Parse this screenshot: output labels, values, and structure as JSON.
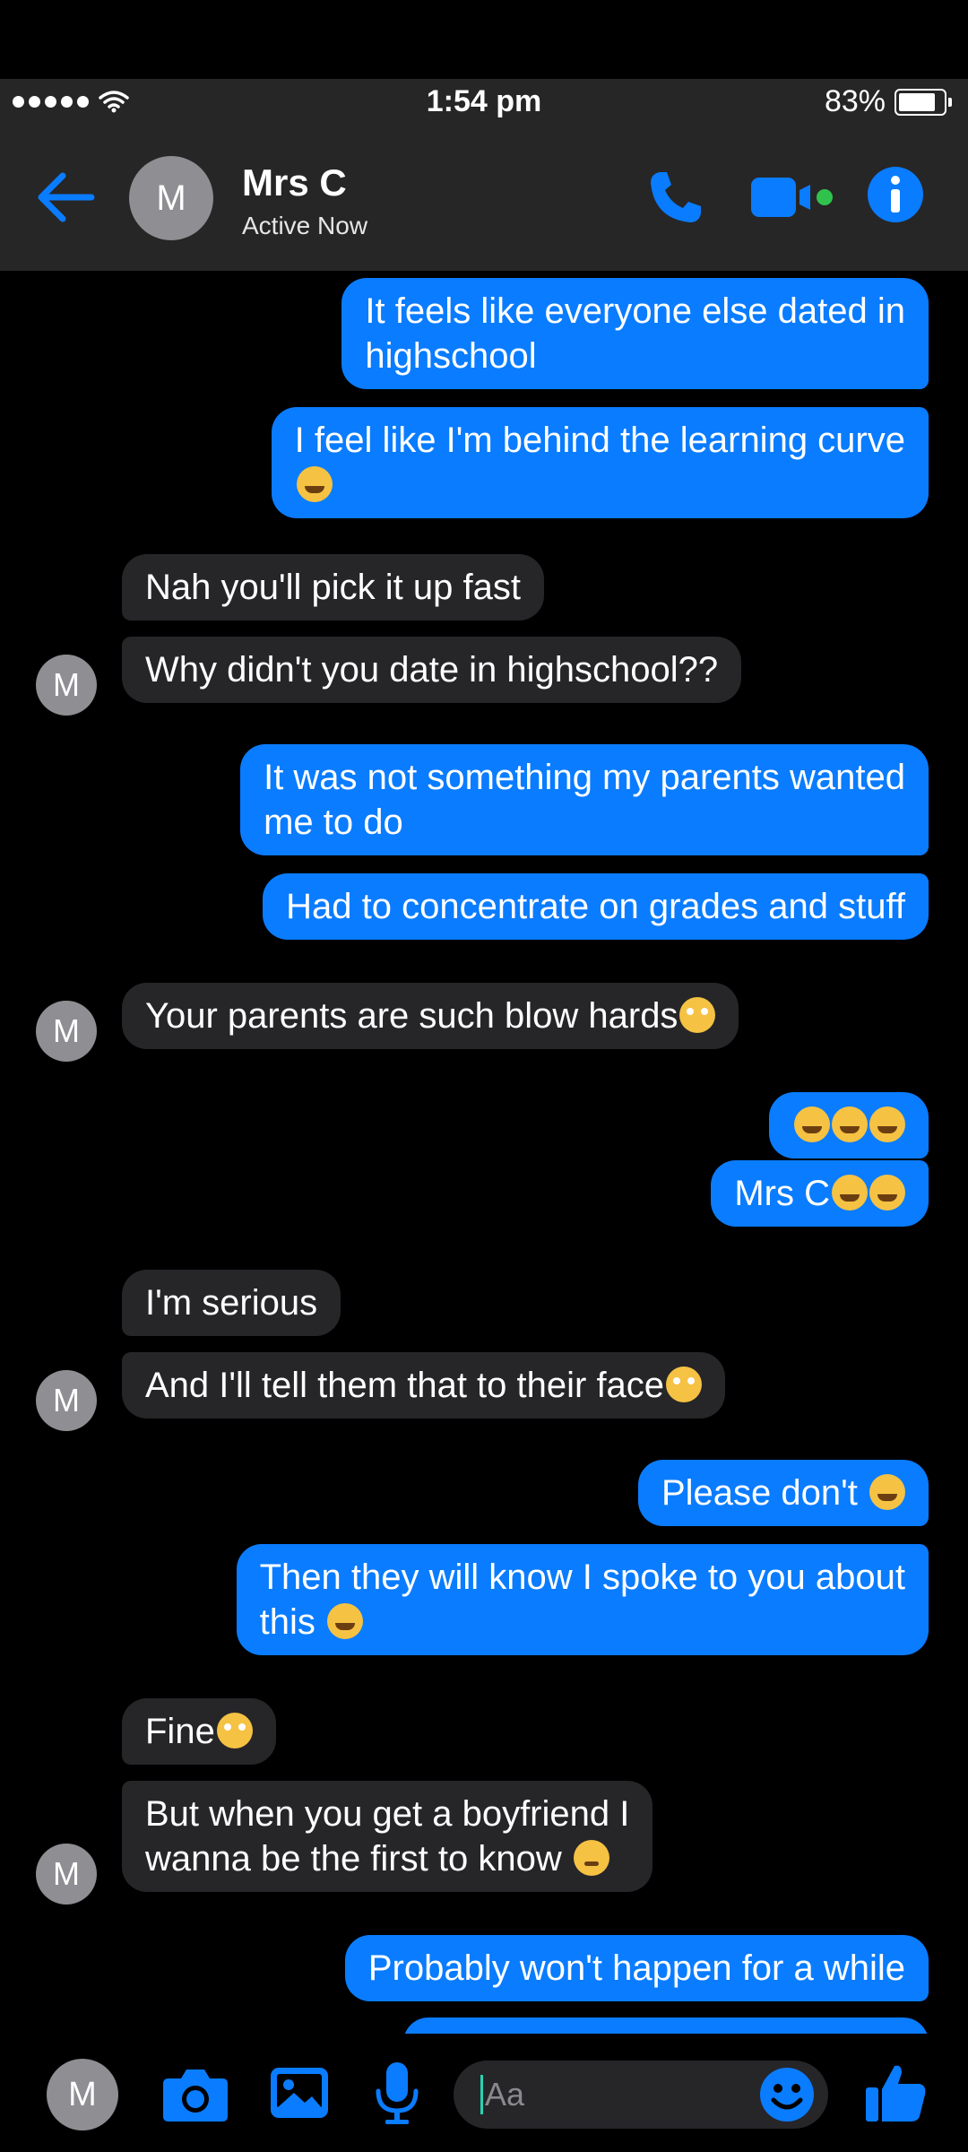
{
  "status_bar": {
    "time": "1:54 pm",
    "battery_text": "83%",
    "battery_level": 0.83
  },
  "header": {
    "avatar_letter": "M",
    "contact_name": "Mrs C",
    "contact_status": "Active Now"
  },
  "messages": [
    {
      "id": "m1",
      "dir": "out",
      "text": "It feels like everyone else dated in\nhighschool",
      "emoji": []
    },
    {
      "id": "m2",
      "dir": "out",
      "text": "I feel like I'm behind the learning curve\n",
      "emoji": [
        "rofl"
      ]
    },
    {
      "id": "m3",
      "dir": "in",
      "text": "Nah you'll pick it up fast",
      "emoji": []
    },
    {
      "id": "m4",
      "dir": "in",
      "text": "Why didn't you date in highschool??",
      "emoji": []
    },
    {
      "id": "m5",
      "dir": "out",
      "text": "It was not something my parents wanted\nme to do",
      "emoji": []
    },
    {
      "id": "m6",
      "dir": "out",
      "text": "Had to concentrate on grades and stuff",
      "emoji": []
    },
    {
      "id": "m7",
      "dir": "in",
      "text": "Your parents are such blow hards",
      "emoji": [
        "eye-roll"
      ]
    },
    {
      "id": "m8",
      "dir": "out",
      "text": "",
      "emoji": [
        "rofl",
        "rofl",
        "rofl"
      ]
    },
    {
      "id": "m9",
      "dir": "out",
      "text": "Mrs C",
      "emoji": [
        "rofl",
        "rofl"
      ]
    },
    {
      "id": "m10",
      "dir": "in",
      "text": "I'm serious",
      "emoji": []
    },
    {
      "id": "m11",
      "dir": "in",
      "text": "And I'll tell them that to their face",
      "emoji": [
        "eye-roll"
      ]
    },
    {
      "id": "m12",
      "dir": "out",
      "text": "Please don't ",
      "emoji": [
        "rofl"
      ]
    },
    {
      "id": "m13",
      "dir": "out",
      "text": "Then they will know I spoke to you about\nthis ",
      "emoji": [
        "rofl"
      ]
    },
    {
      "id": "m14",
      "dir": "in",
      "text": "Fine",
      "emoji": [
        "eye-roll"
      ]
    },
    {
      "id": "m15",
      "dir": "in",
      "text": "But when you get a boyfriend I\nwanna be the first to know ",
      "emoji": [
        "wink"
      ]
    },
    {
      "id": "m16",
      "dir": "out",
      "text": "Probably won't happen for a while",
      "emoji": []
    }
  ],
  "sender_avatar_letter": "M",
  "composer": {
    "avatar_letter": "M",
    "placeholder": "Aa"
  },
  "icons": [
    "back-arrow-icon",
    "phone-icon",
    "video-camera-icon",
    "info-icon",
    "camera-icon",
    "photo-icon",
    "microphone-icon",
    "emoji-icon",
    "thumbs-up-icon"
  ],
  "colors": {
    "accent": "#0a7cff",
    "outgoing_bubble": "#0a7cff",
    "incoming_bubble": "#262629",
    "header_bg": "#262626",
    "active_dot": "#31c24d"
  }
}
